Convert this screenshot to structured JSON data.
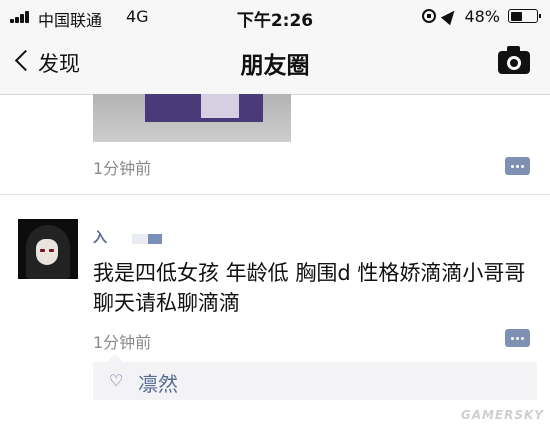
{
  "status_bar": {
    "carrier": "中国联通",
    "network": "4G",
    "time": "下午2:26",
    "battery_percent": "48%",
    "battery_level": 0.48,
    "icons": [
      "signal-icon",
      "orientation-lock-icon",
      "location-icon",
      "battery-icon"
    ]
  },
  "nav": {
    "back_label": "发现",
    "title": "朋友圈",
    "camera_icon": "camera-icon"
  },
  "posts": [
    {
      "time": "1分钟前",
      "comment_icon": "comment-icon"
    },
    {
      "username": "入",
      "text": "我是四低女孩 年龄低 胸围d 性格娇滴滴小哥哥聊天请私聊滴滴",
      "time": "1分钟前",
      "comment_icon": "comment-icon",
      "likes": [
        "凛然"
      ],
      "like_icon": "heart-icon"
    }
  ],
  "watermark": "GAMERSKY",
  "colors": {
    "link": "#576b95",
    "meta": "#8a8a8a",
    "comment_button": "#7f91b3"
  }
}
